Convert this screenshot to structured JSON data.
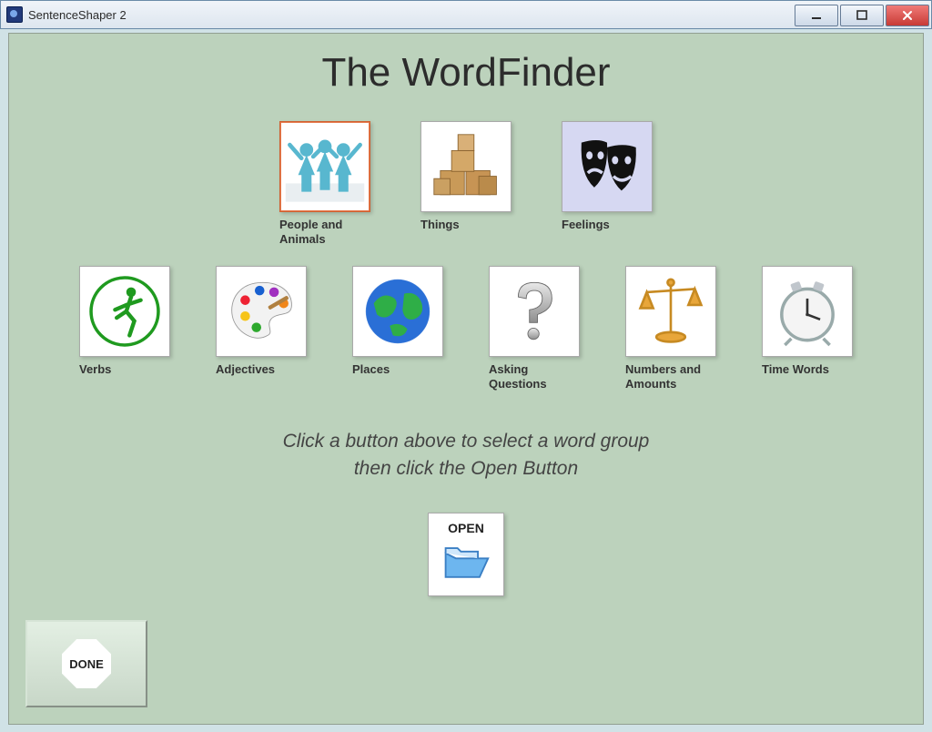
{
  "window": {
    "title": "SentenceShaper 2"
  },
  "page": {
    "heading": "The WordFinder",
    "instruction_line1": "Click a button above to select a word group",
    "instruction_line2": "then click the Open Button"
  },
  "categories": [
    {
      "id": "people-animals",
      "label": "People and Animals",
      "selected": true
    },
    {
      "id": "things",
      "label": "Things",
      "selected": false
    },
    {
      "id": "feelings",
      "label": "Feelings",
      "selected": false
    },
    {
      "id": "verbs",
      "label": "Verbs",
      "selected": false
    },
    {
      "id": "adjectives",
      "label": "Adjectives",
      "selected": false
    },
    {
      "id": "places",
      "label": "Places",
      "selected": false
    },
    {
      "id": "asking",
      "label": "Asking Questions",
      "selected": false
    },
    {
      "id": "numbers",
      "label": "Numbers and Amounts",
      "selected": false
    },
    {
      "id": "time",
      "label": "Time Words",
      "selected": false
    }
  ],
  "buttons": {
    "open": "OPEN",
    "done": "DONE"
  }
}
